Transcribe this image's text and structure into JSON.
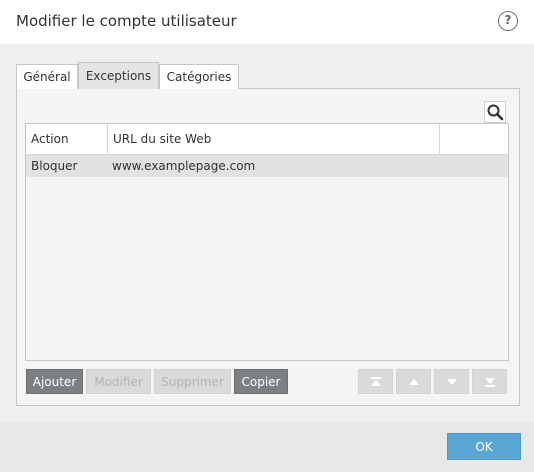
{
  "dialog": {
    "title": "Modifier le compte utilisateur",
    "help_symbol": "?"
  },
  "tabs": [
    {
      "label": "Général",
      "active": false
    },
    {
      "label": "Exceptions",
      "active": true
    },
    {
      "label": "Catégories",
      "active": false
    }
  ],
  "table": {
    "columns": [
      "Action",
      "URL du site Web"
    ],
    "rows": [
      {
        "action": "Bloquer",
        "url": "www.examplepage.com"
      }
    ]
  },
  "buttons": {
    "add": "Ajouter",
    "edit": "Modifier",
    "delete": "Supprimer",
    "copy": "Copier"
  },
  "ok": "OK",
  "colors": {
    "accent": "#5aa7d6",
    "enabled_button": "#7a8084",
    "disabled_button": "#dadada",
    "selected_row": "#e2e2e2"
  }
}
